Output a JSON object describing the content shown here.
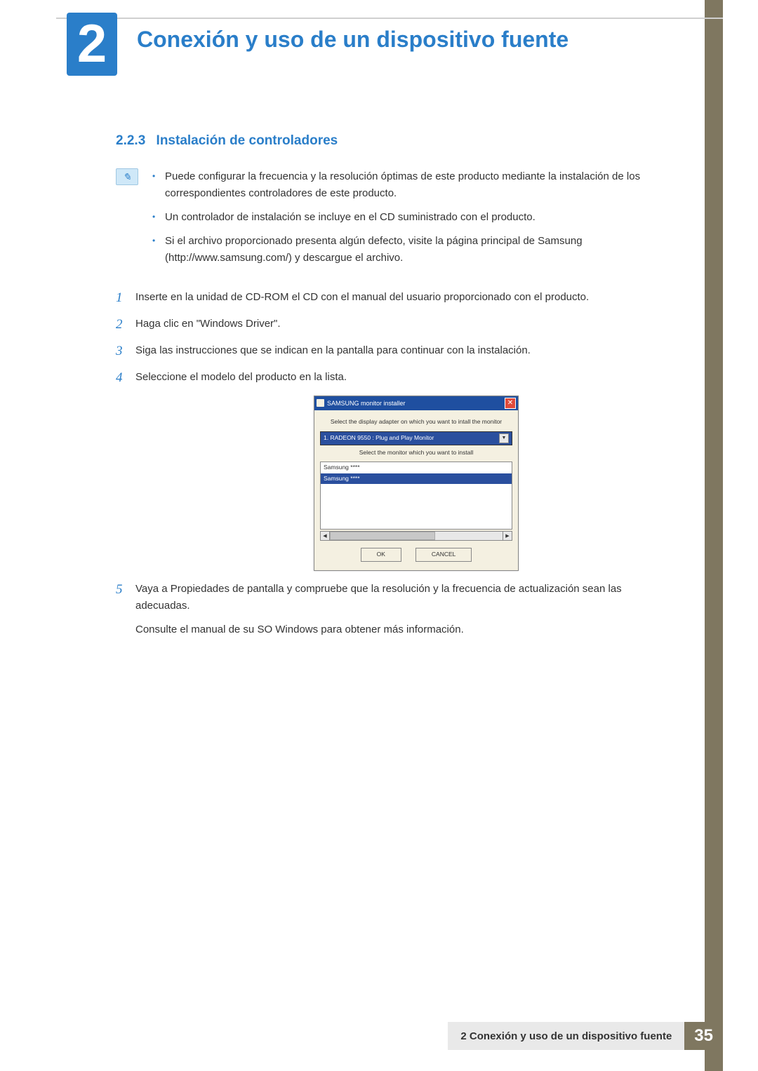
{
  "chapter": {
    "number": "2",
    "title": "Conexión y uso de un dispositivo fuente"
  },
  "section": {
    "number": "2.2.3",
    "title": "Instalación de controladores"
  },
  "notes": [
    "Puede configurar la frecuencia y la resolución óptimas de este producto mediante la instalación de los correspondientes controladores de este producto.",
    "Un controlador de instalación se incluye en el CD suministrado con el producto.",
    "Si el archivo proporcionado presenta algún defecto, visite la página principal de Samsung (http://www.samsung.com/) y descargue el archivo."
  ],
  "steps": {
    "s1": {
      "num": "1",
      "text": "Inserte en la unidad de CD-ROM el CD con el manual del usuario proporcionado con el producto."
    },
    "s2": {
      "num": "2",
      "text": "Haga clic en \"Windows Driver\"."
    },
    "s3": {
      "num": "3",
      "text": "Siga las instrucciones que se indican en la pantalla para continuar con la instalación."
    },
    "s4": {
      "num": "4",
      "text": "Seleccione el modelo del producto en la lista."
    },
    "s5": {
      "num": "5",
      "text": "Vaya a Propiedades de pantalla y compruebe que la resolución y la frecuencia de actualización sean las adecuadas.",
      "extra": "Consulte el manual de su SO Windows para obtener más información."
    }
  },
  "installer": {
    "title": "SAMSUNG monitor installer",
    "label1": "Select the display adapter on which you want to intall the monitor",
    "adapter": "1. RADEON 9550 : Plug and Play Monitor",
    "label2": "Select the monitor which you want to install",
    "item1": "Samsung ****",
    "item2": "Samsung ****",
    "ok": "OK",
    "cancel": "CANCEL"
  },
  "footer": {
    "text": "2 Conexión y uso de un dispositivo fuente",
    "page": "35"
  }
}
